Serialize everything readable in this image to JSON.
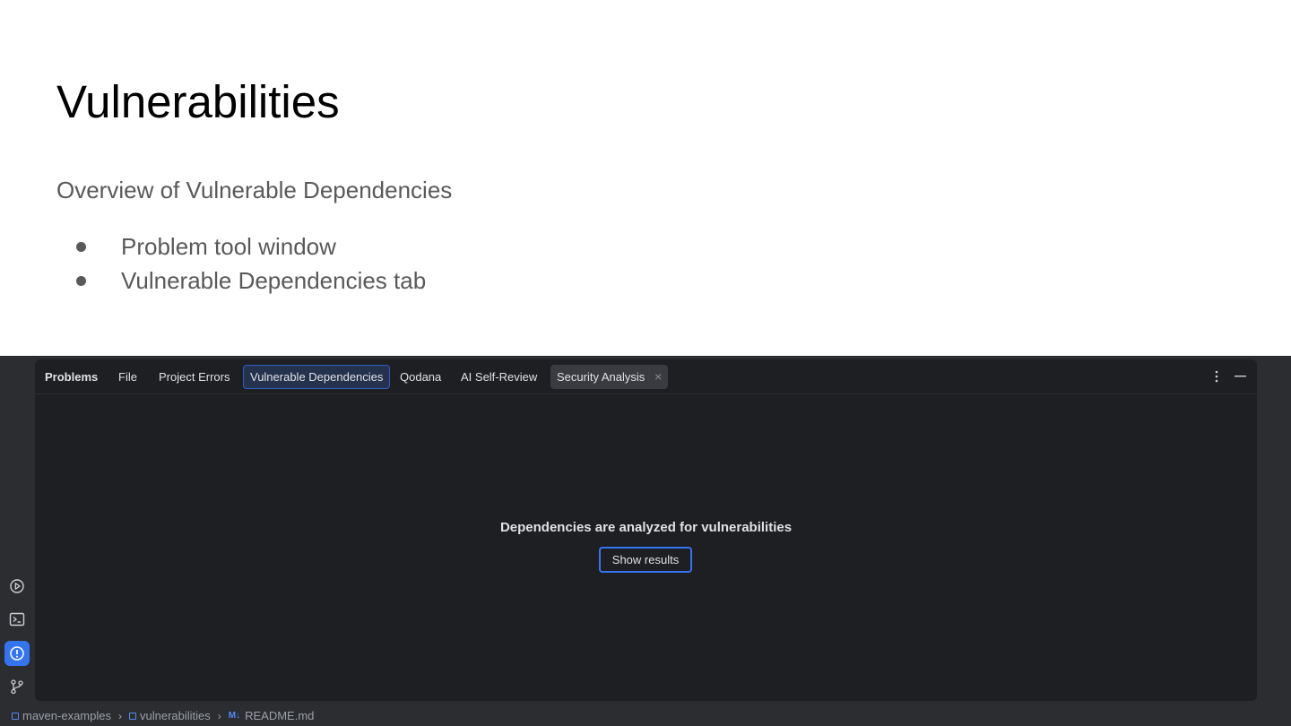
{
  "slide": {
    "title": "Vulnerabilities",
    "subtitle": "Overview of Vulnerable Dependencies",
    "bullets": [
      "Problem tool window",
      "Vulnerable Dependencies tab"
    ]
  },
  "ide": {
    "tool_window": {
      "title": "Problems",
      "tabs": [
        "File",
        "Project Errors",
        "Vulnerable Dependencies",
        "Qodana",
        "AI Self-Review",
        "Security Analysis"
      ],
      "selected_tab": "Vulnerable Dependencies",
      "closable_tab": "Security Analysis",
      "close_glyph": "×",
      "empty_state": {
        "message": "Dependencies are analyzed for vulnerabilities",
        "button": "Show results"
      }
    },
    "stripe_icons": [
      "run-icon",
      "terminal-icon",
      "problems-icon",
      "git-branch-icon"
    ],
    "active_stripe": "problems-icon",
    "breadcrumbs": [
      "maven-examples",
      "vulnerabilities",
      "README.md"
    ],
    "md_badge": "M↓"
  },
  "colors": {
    "accent": "#3574f0",
    "panel_bg": "#1e1f22",
    "ide_bg": "#2b2d30",
    "selected_tab_bg": "#25324d"
  }
}
